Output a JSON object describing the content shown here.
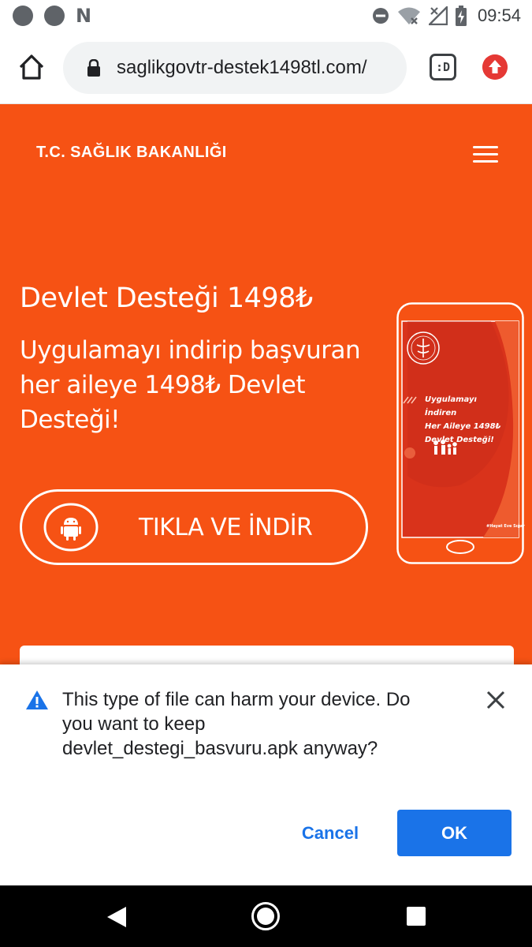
{
  "status_bar": {
    "notification_icons": [
      "notification-dot-icon",
      "notification-dot-icon",
      "n-logo-icon"
    ],
    "notification_letter": "N",
    "system_icons": [
      "do-not-disturb-icon",
      "wifi-off-icon",
      "no-signal-icon",
      "battery-charging-icon"
    ],
    "time": "09:54"
  },
  "browser": {
    "url": "saglikgovtr-destek1498tl.com/",
    "tab_switcher_label": ":D",
    "icons": [
      "home-icon",
      "lock-icon",
      "tab-switcher-icon",
      "update-arrow-icon"
    ]
  },
  "page": {
    "brand": "T.C. SAĞLIK BAKANLIĞI",
    "hero_title": "Devlet Desteği 1498₺",
    "hero_subtitle": "Uygulamayı indirip başvuran her aileye 1498₺ Devlet Desteği!",
    "download_button": "TIKLA VE İNDİR",
    "phone_caption": [
      "Uygulamayı İndiren",
      "Her Aileye 1498₺",
      "Devlet Desteği!"
    ],
    "phone_footer": "#Hayat Eve Sığar",
    "colors": {
      "background": "#f65214",
      "phone_screen": "#d9331b"
    }
  },
  "download_warning": {
    "message": "This type of file can harm your device. Do you want to keep devlet_destegi_basvuru.apk anyway?",
    "cancel_label": "Cancel",
    "ok_label": "OK",
    "colors": {
      "accent": "#1a73e8",
      "warning": "#1a73e8"
    }
  },
  "nav_bar": {
    "icons": [
      "back-icon",
      "home-circle-icon",
      "recents-icon"
    ]
  }
}
